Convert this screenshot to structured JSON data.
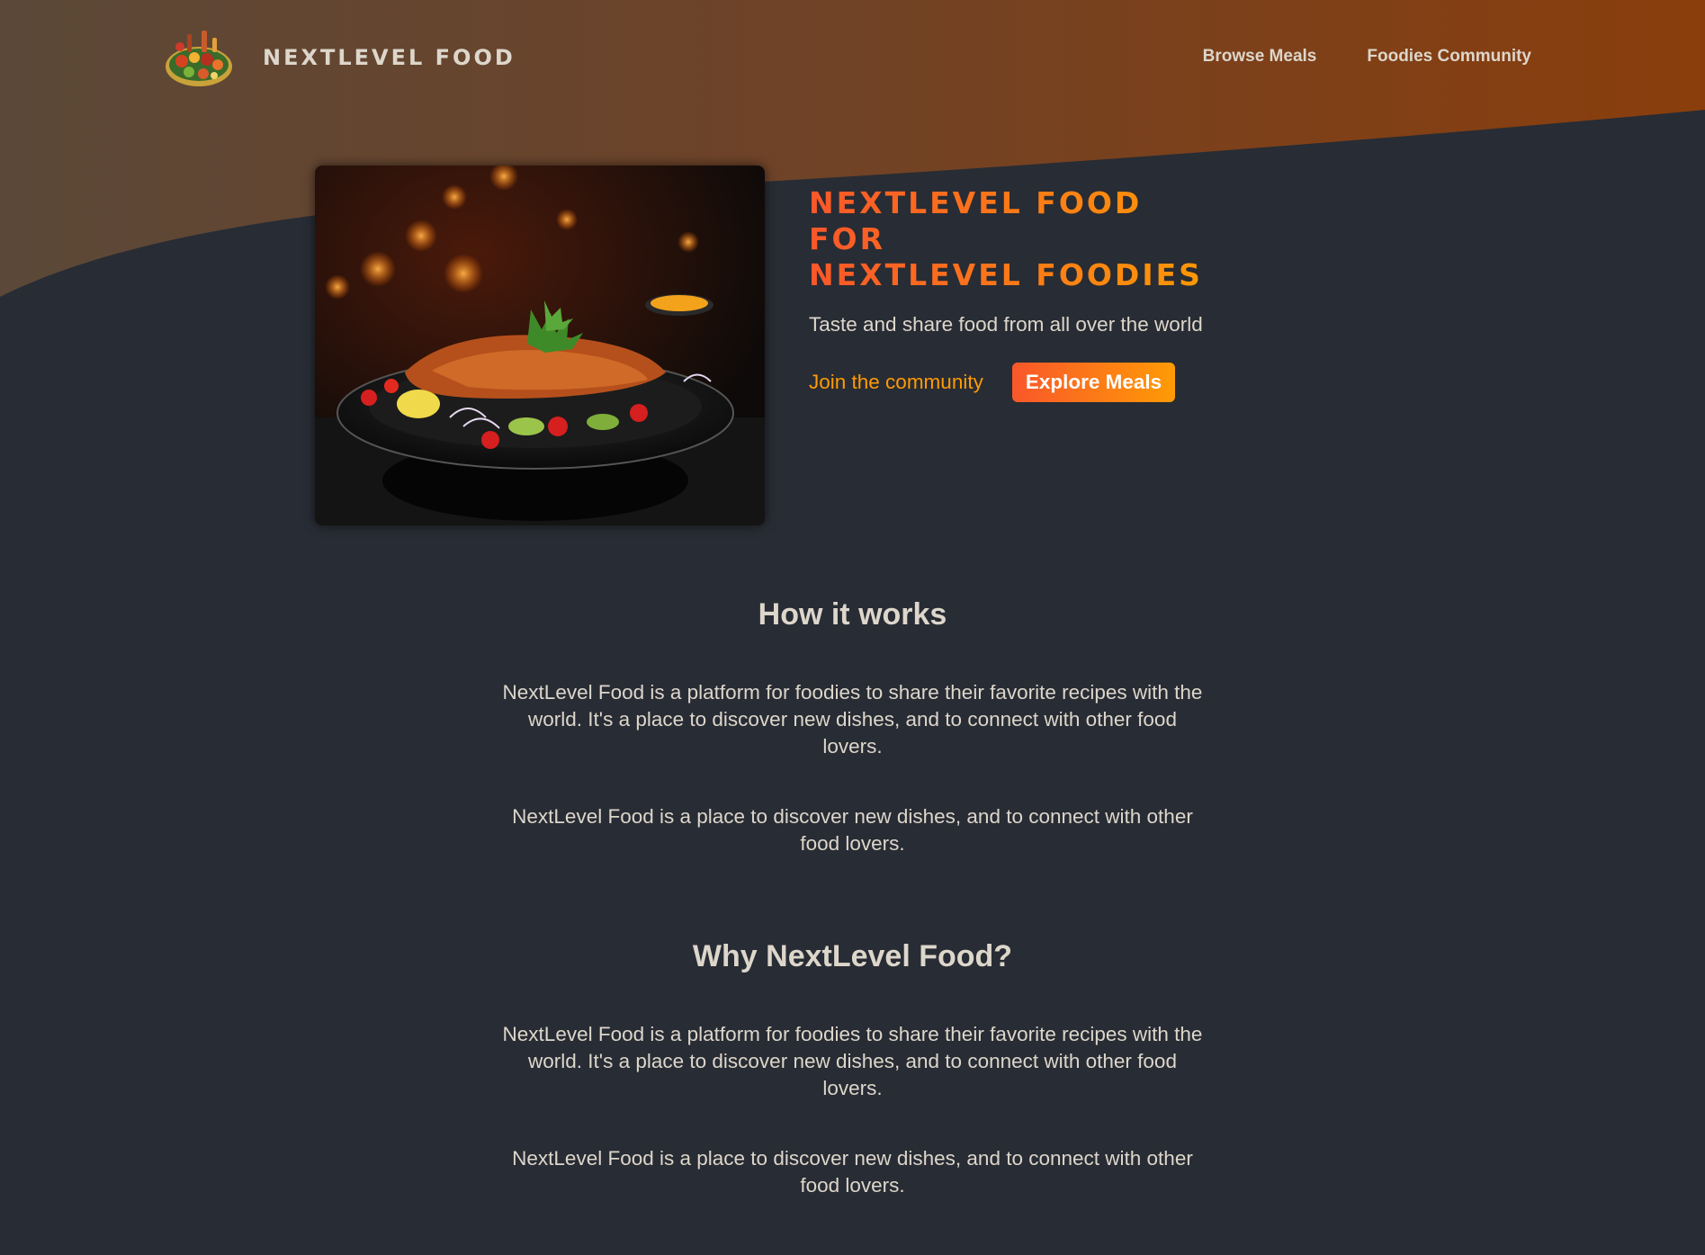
{
  "header": {
    "logo_text": "NextLevel Food",
    "nav": [
      {
        "label": "Browse Meals"
      },
      {
        "label": "Foodies Community"
      }
    ]
  },
  "hero": {
    "title_line1": "NextLevel Food for",
    "title_line2": "NextLevel Foodies",
    "subtitle": "Taste and share food from all over the world",
    "community_link": "Join the community",
    "explore_button": "Explore Meals"
  },
  "sections": [
    {
      "heading": "How it works",
      "paragraphs": [
        "NextLevel Food is a platform for foodies to share their favorite recipes with the world. It's a place to discover new dishes, and to connect with other food lovers.",
        "NextLevel Food is a place to discover new dishes, and to connect with other food lovers."
      ]
    },
    {
      "heading": "Why NextLevel Food?",
      "paragraphs": [
        "NextLevel Food is a platform for foodies to share their favorite recipes with the world. It's a place to discover new dishes, and to connect with other food lovers.",
        "NextLevel Food is a place to discover new dishes, and to connect with other food lovers."
      ]
    }
  ],
  "colors": {
    "background": "#282c34",
    "accent_start": "#f9572a",
    "accent_end": "#ff9b05",
    "text": "#ddd6cb"
  }
}
